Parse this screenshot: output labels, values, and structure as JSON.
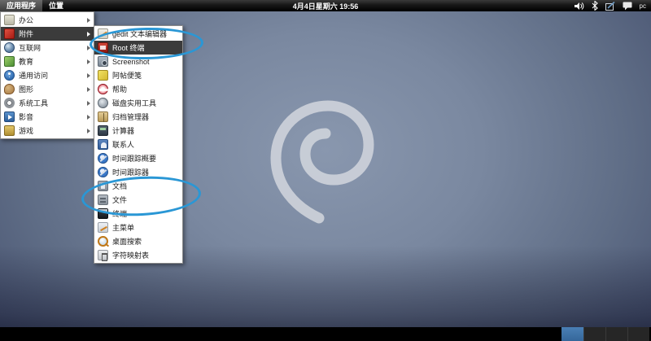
{
  "panel": {
    "menus": [
      {
        "label": "应用程序",
        "active": true
      },
      {
        "label": "位置",
        "active": false
      }
    ],
    "clock": "4月4日星期六 19:56",
    "tray": [
      {
        "icon": "volume-icon"
      },
      {
        "icon": "bluetooth-icon"
      },
      {
        "icon": "tablet-pen-icon"
      },
      {
        "icon": "chat-icon"
      }
    ],
    "device_label": "pc"
  },
  "app_menu": {
    "categories": [
      {
        "label": "办公",
        "icon": "office",
        "selected": false
      },
      {
        "label": "附件",
        "icon": "accessories",
        "selected": true
      },
      {
        "label": "互联网",
        "icon": "internet",
        "selected": false
      },
      {
        "label": "教育",
        "icon": "education",
        "selected": false
      },
      {
        "label": "通用访问",
        "icon": "access",
        "selected": false
      },
      {
        "label": "图形",
        "icon": "graphics",
        "selected": false
      },
      {
        "label": "系统工具",
        "icon": "system",
        "selected": false
      },
      {
        "label": "影音",
        "icon": "av",
        "selected": false
      },
      {
        "label": "游戏",
        "icon": "games",
        "selected": false
      }
    ]
  },
  "submenu": {
    "items": [
      {
        "label": "gedit 文本编辑器",
        "icon": "gedit",
        "selected": false
      },
      {
        "label": "Root 终端",
        "icon": "rootterm",
        "selected": true
      },
      {
        "label": "Screenshot",
        "icon": "screenshot",
        "selected": false
      },
      {
        "label": "阿帖便笺",
        "icon": "notes",
        "selected": false
      },
      {
        "label": "帮助",
        "icon": "help",
        "selected": false
      },
      {
        "label": "磁盘实用工具",
        "icon": "disk",
        "selected": false
      },
      {
        "label": "归档管理器",
        "icon": "archive",
        "selected": false
      },
      {
        "label": "计算器",
        "icon": "calc",
        "selected": false
      },
      {
        "label": "联系人",
        "icon": "contacts",
        "selected": false
      },
      {
        "label": "时间跟踪概要",
        "icon": "time",
        "selected": false
      },
      {
        "label": "时间跟踪器",
        "icon": "time",
        "selected": false
      },
      {
        "label": "文档",
        "icon": "docs",
        "selected": false
      },
      {
        "label": "文件",
        "icon": "files",
        "selected": false
      },
      {
        "label": "终端",
        "icon": "term",
        "selected": false
      },
      {
        "label": "主菜单",
        "icon": "mainmenu",
        "selected": false
      },
      {
        "label": "桌面搜索",
        "icon": "search",
        "selected": false
      },
      {
        "label": "字符映射表",
        "icon": "charmap",
        "selected": false
      }
    ]
  },
  "annotations": {
    "color": "#2a97d5",
    "items": [
      {
        "target": "Root 终端"
      },
      {
        "target": "文件"
      }
    ]
  },
  "taskbar": {
    "buttons": [
      {
        "style": "active"
      },
      {
        "style": "inactive"
      },
      {
        "style": "inactive"
      },
      {
        "style": "inactive"
      }
    ]
  },
  "colors": {
    "selection": "#3b3b3b",
    "panel": "#000000",
    "annotation": "#2a97d5",
    "taskbar_active": "#3b72a8"
  }
}
